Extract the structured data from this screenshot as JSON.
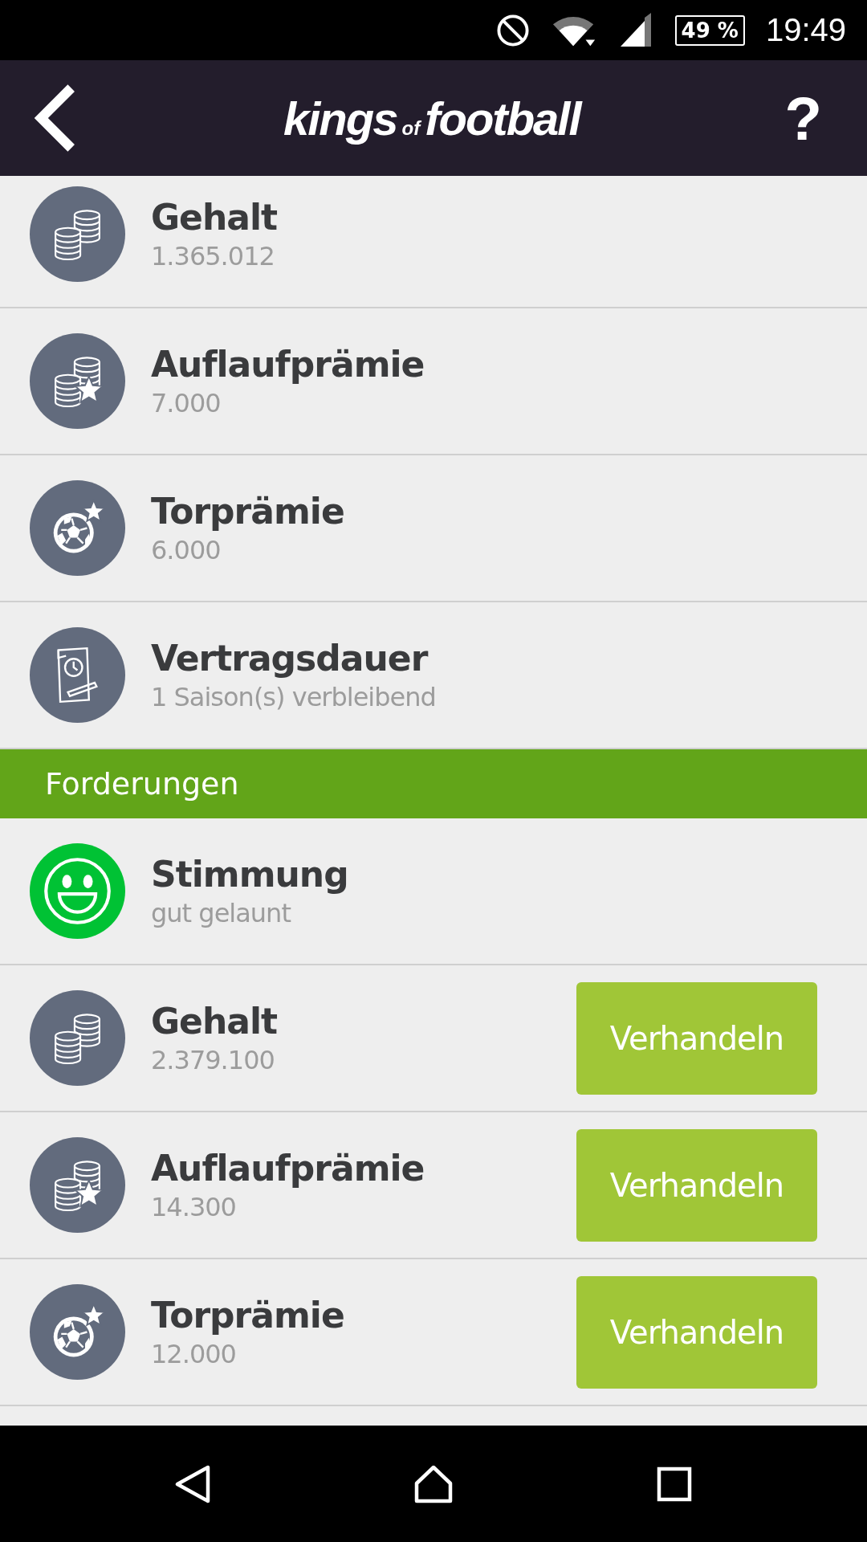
{
  "status_bar": {
    "battery": "49 %",
    "time": "19:49"
  },
  "header": {
    "logo": [
      "kings",
      "of",
      "football"
    ],
    "help": "?"
  },
  "contract_rows": [
    {
      "kind": "salary",
      "title": "Gehalt",
      "value": "1.365.012"
    },
    {
      "kind": "appearance_bonus",
      "title": "Auflaufprämie",
      "value": "7.000"
    },
    {
      "kind": "goal_bonus",
      "title": "Torprämie",
      "value": "6.000"
    },
    {
      "kind": "contract",
      "title": "Vertragsdauer",
      "value": "1 Saison(s) verbleibend"
    }
  ],
  "section": {
    "title": "Forderungen"
  },
  "demand_rows": [
    {
      "kind": "mood",
      "title": "Stimmung",
      "value": "gut gelaunt"
    },
    {
      "kind": "salary",
      "title": "Gehalt",
      "value": "2.379.100",
      "action": "Verhandeln"
    },
    {
      "kind": "appearance_bonus",
      "title": "Auflaufprämie",
      "value": "14.300",
      "action": "Verhandeln"
    },
    {
      "kind": "goal_bonus",
      "title": "Torprämie",
      "value": "12.000",
      "action": "Verhandeln"
    }
  ]
}
